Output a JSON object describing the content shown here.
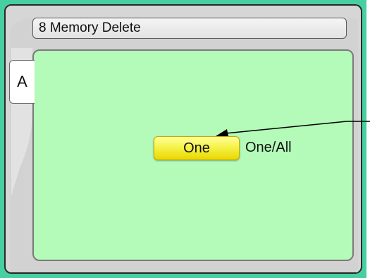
{
  "screen": {
    "title": "8 Memory Delete",
    "tab_label": "A",
    "button_label": "One",
    "option_label": "One/All"
  },
  "colors": {
    "outer_background": "#46cfa0",
    "panel_background": "#b4fab8",
    "button_yellow": "#f6f24a",
    "bezel": "#d6d6d6"
  },
  "icons": {
    "callout": "callout-arrow-icon"
  }
}
